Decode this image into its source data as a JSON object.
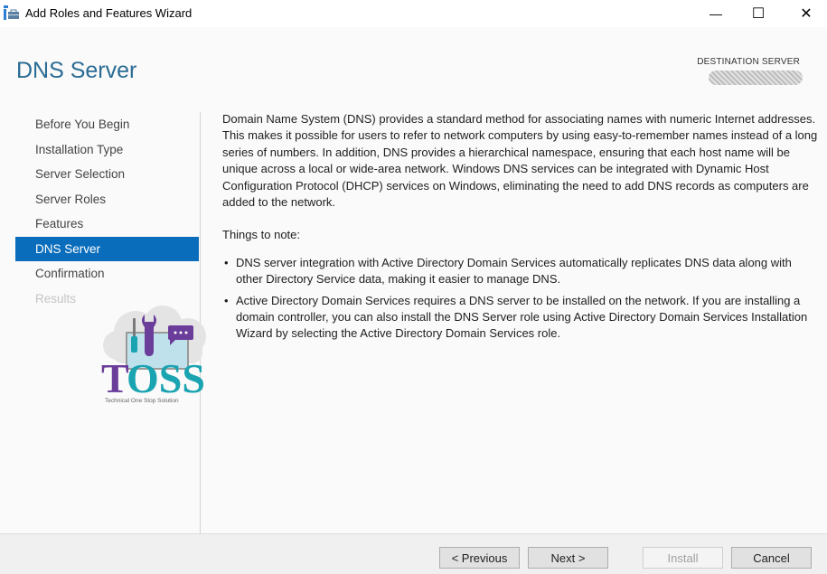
{
  "window": {
    "title": "Add Roles and Features Wizard",
    "controls": {
      "minimize": "—",
      "maximize": "☐",
      "close": "✕"
    }
  },
  "header": {
    "page_title": "DNS Server",
    "destination_label": "DESTINATION SERVER",
    "destination_value": ""
  },
  "nav": {
    "items": [
      {
        "label": "Before You Begin",
        "state": "normal"
      },
      {
        "label": "Installation Type",
        "state": "normal"
      },
      {
        "label": "Server Selection",
        "state": "normal"
      },
      {
        "label": "Server Roles",
        "state": "normal"
      },
      {
        "label": "Features",
        "state": "normal"
      },
      {
        "label": "DNS Server",
        "state": "active"
      },
      {
        "label": "Confirmation",
        "state": "normal"
      },
      {
        "label": "Results",
        "state": "disabled"
      }
    ]
  },
  "content": {
    "description": "Domain Name System (DNS) provides a standard method for associating names with numeric Internet addresses. This makes it possible for users to refer to network computers by using easy-to-remember names instead of a long series of numbers. In addition, DNS provides a hierarchical namespace, ensuring that each host name will be unique across a local or wide-area network. Windows DNS services can be integrated with Dynamic Host Configuration Protocol (DHCP) services on Windows, eliminating the need to add DNS records as computers are added to the network.",
    "notes_title": "Things to note:",
    "notes": [
      "DNS server integration with Active Directory Domain Services automatically replicates DNS data along with other Directory Service data, making it easier to manage DNS.",
      "Active Directory Domain Services requires a DNS server to be installed on the network. If you are installing a domain controller, you can also install the DNS Server role using Active Directory Domain Services Installation Wizard by selecting the Active Directory Domain Services role."
    ]
  },
  "watermark": {
    "text": "TOSS",
    "tagline": "Technical One Stop Solution"
  },
  "footer": {
    "previous": "< Previous",
    "next": "Next >",
    "install": "Install",
    "cancel": "Cancel"
  },
  "colors": {
    "accent": "#0a6dbb",
    "title": "#2b6c94",
    "logo_purple": "#6a3d9a",
    "logo_teal": "#1aa3b0"
  }
}
